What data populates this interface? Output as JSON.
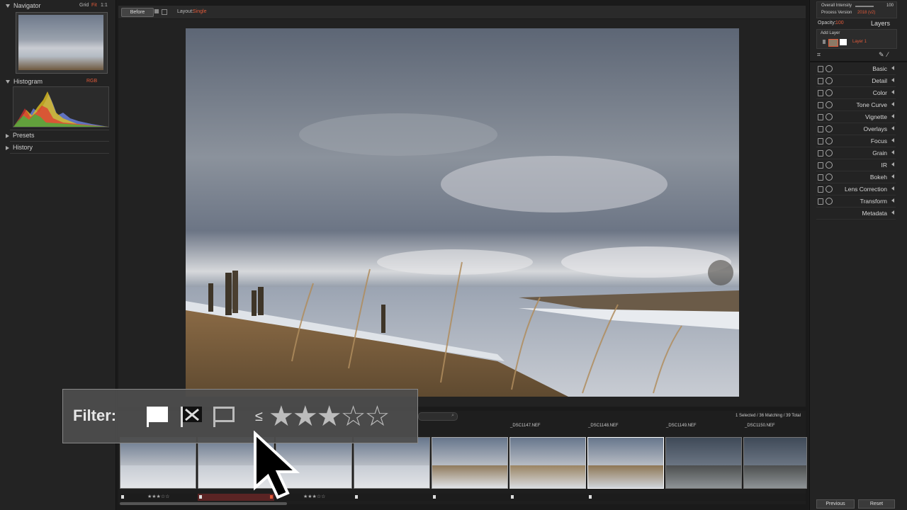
{
  "left_panel": {
    "navigator": {
      "title": "Navigator",
      "grid": "Grid",
      "fit": "Fit",
      "one_to_one": "1:1"
    },
    "histogram": {
      "title": "Histogram",
      "mode": "RGB"
    },
    "presets": "Presets",
    "history": "History"
  },
  "toolbar": {
    "before": "Before",
    "layout_label": "Layout:",
    "layout_value": "Single"
  },
  "right_panel": {
    "overall_intensity_label": "Overall Intensity",
    "overall_intensity_value": "100",
    "process_version_label": "Process Version",
    "process_version_value": "2018 (v2)",
    "opacity_label": "Opacity:",
    "opacity_value": "100",
    "layers_title": "Layers",
    "add_layer": "Add Layer",
    "layer_name": "Layer 1",
    "adjustments": [
      "Basic",
      "Detail",
      "Color",
      "Tone Curve",
      "Vignette",
      "Overlays",
      "Focus",
      "Grain",
      "IR",
      "Bokeh",
      "Lens Correction",
      "Transform"
    ],
    "metadata": "Metadata",
    "previous": "Previous",
    "reset": "Reset"
  },
  "filmstrip": {
    "status": "1 Selected / 36 Matching / 39 Total",
    "filenames": [
      "_DSC1147.NEF",
      "_DSC1148.NEF",
      "_DSC1149.NEF",
      "_DSC1150.NEF"
    ],
    "ratings": [
      "★★★☆☆",
      "★★★☆☆"
    ]
  },
  "filter_overlay": {
    "label": "Filter:",
    "lte": "≤",
    "stars": "★★★☆☆"
  },
  "colors": {
    "accent": "#e05a3a",
    "panel": "#232323",
    "background": "#1a1a1a"
  }
}
